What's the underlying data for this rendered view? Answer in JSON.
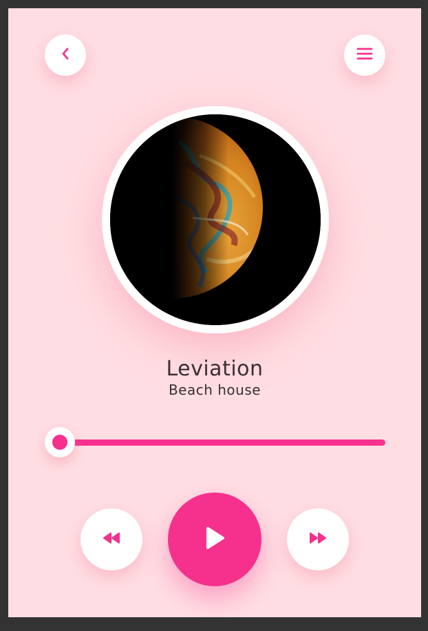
{
  "header": {
    "back_icon": "chevron-left-icon",
    "menu_icon": "hamburger-menu-icon"
  },
  "track": {
    "title": "Leviation",
    "artist": "Beach house"
  },
  "progress": {
    "fraction": 0.0
  },
  "controls": {
    "previous_icon": "rewind-icon",
    "play_icon": "play-icon",
    "next_icon": "fast-forward-icon"
  },
  "colors": {
    "background": "#ffdee3",
    "accent": "#f5318d",
    "surface": "#ffffff",
    "text": "#3a3035"
  }
}
